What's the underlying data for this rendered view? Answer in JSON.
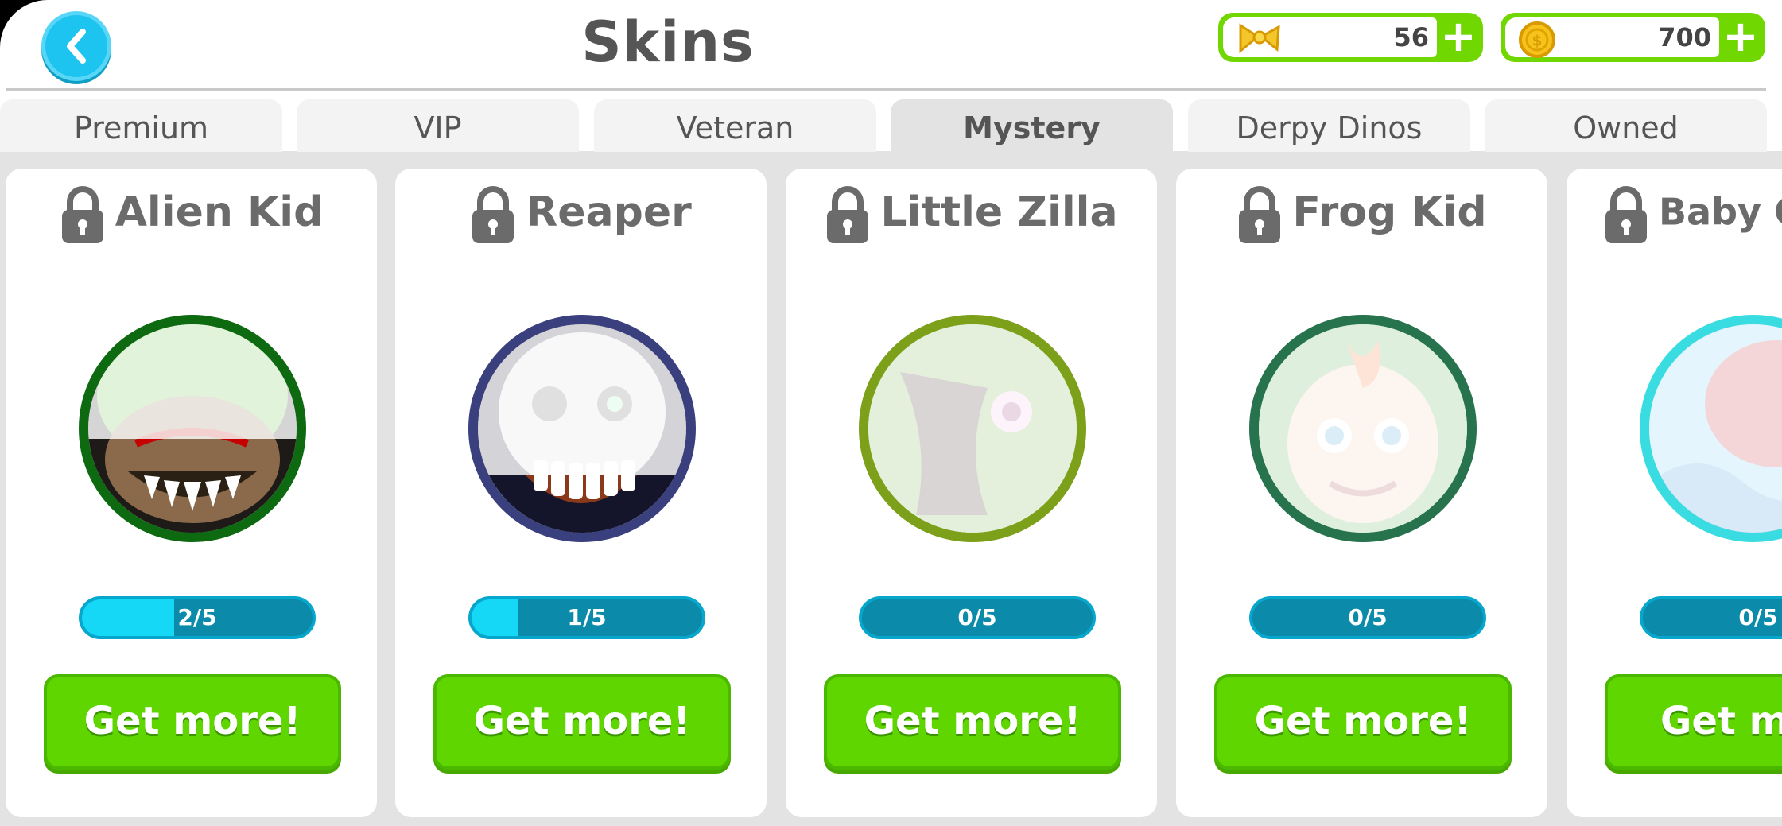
{
  "header": {
    "title": "Skins",
    "back_icon": "chevron-left-icon"
  },
  "currencies": [
    {
      "icon": "bow-icon",
      "amount": "56",
      "plus": "+"
    },
    {
      "icon": "coin-icon",
      "amount": "700",
      "plus": "+"
    }
  ],
  "tabs": [
    {
      "label": "Premium",
      "active": false
    },
    {
      "label": "VIP",
      "active": false
    },
    {
      "label": "Veteran",
      "active": false
    },
    {
      "label": "Mystery",
      "active": true
    },
    {
      "label": "Derpy Dinos",
      "active": false
    },
    {
      "label": "Owned",
      "active": false
    }
  ],
  "cards": [
    {
      "name": "Alien Kid",
      "progress": "2/5",
      "progress_fraction": 0.4,
      "button": "Get more!",
      "ring_color": "#0e6a10"
    },
    {
      "name": "Reaper",
      "progress": "1/5",
      "progress_fraction": 0.2,
      "button": "Get more!",
      "ring_color": "#3a3f7e"
    },
    {
      "name": "Little Zilla",
      "progress": "0/5",
      "progress_fraction": 0,
      "button": "Get more!",
      "ring_color": "#7ca01a"
    },
    {
      "name": "Frog Kid",
      "progress": "0/5",
      "progress_fraction": 0,
      "button": "Get more!",
      "ring_color": "#27734d"
    },
    {
      "name": "Baby O",
      "progress": "0/5",
      "progress_fraction": 0,
      "button": "Get mo",
      "ring_color": "#39dce0"
    }
  ],
  "colors": {
    "accent_green": "#5fd600",
    "accent_cyan": "#1ec4f0"
  }
}
